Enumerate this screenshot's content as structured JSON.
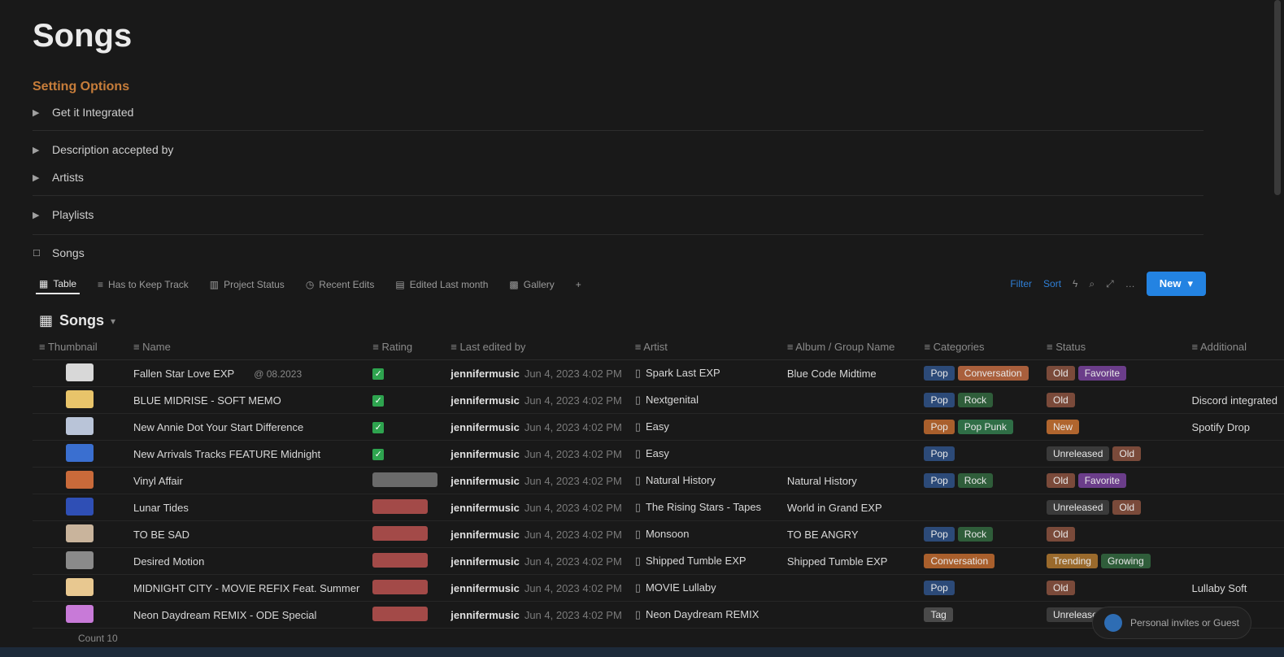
{
  "page": {
    "title": "Songs"
  },
  "setup": {
    "label": "Setting Options",
    "items": [
      {
        "label": "Get it Integrated"
      },
      {
        "label": "Description accepted by"
      },
      {
        "label": "Artists"
      },
      {
        "label": "Playlists"
      },
      {
        "label": "Songs"
      }
    ]
  },
  "views": [
    {
      "label": "Table",
      "icon": "table-icon"
    },
    {
      "label": "Has to Keep Track",
      "icon": "list-icon"
    },
    {
      "label": "Project Status",
      "icon": "board-icon"
    },
    {
      "label": "Recent Edits",
      "icon": "clock-icon"
    },
    {
      "label": "Edited Last month",
      "icon": "calendar-icon"
    },
    {
      "label": "Gallery",
      "icon": "gallery-icon"
    }
  ],
  "toolbar": {
    "filter": "Filter",
    "sort": "Sort",
    "new_label": "New"
  },
  "database": {
    "title": "Songs"
  },
  "columns": [
    "Thumbnail",
    "Name",
    "Rating",
    "Last edited by",
    "Artist",
    "Album / Group Name",
    "Categories",
    "Status",
    "Additional"
  ],
  "rows": [
    {
      "thumb": "#d8d8d8",
      "name": "Fallen Star Love EXP",
      "extra": "@ 08.2023",
      "rating": "check",
      "author": "jennifermusic",
      "date": "Jun 4, 2023 4:02 PM",
      "artist": "Spark Last EXP",
      "album": "Blue Code Midtime",
      "categories": [
        {
          "t": "Pop",
          "c": "#2c4a78"
        },
        {
          "t": "Conversation",
          "c": "#a95f3c"
        }
      ],
      "status": [
        {
          "t": "Old",
          "c": "#7a4a3a"
        },
        {
          "t": "Favorite",
          "c": "#6b3d8a"
        }
      ],
      "additional": ""
    },
    {
      "thumb": "#e8c46a",
      "name": "BLUE MIDRISE - SOFT MEMO",
      "extra": "",
      "rating": "check",
      "author": "jennifermusic",
      "date": "Jun 4, 2023 4:02 PM",
      "artist": "Nextgenital",
      "album": "",
      "categories": [
        {
          "t": "Pop",
          "c": "#2c4a78"
        },
        {
          "t": "Rock",
          "c": "#2f5d3a"
        }
      ],
      "status": [
        {
          "t": "Old",
          "c": "#7a4a3a"
        }
      ],
      "additional": "Discord integrated"
    },
    {
      "thumb": "#b9c4d8",
      "name": "New Annie Dot Your Start Difference",
      "extra": "",
      "rating": "check",
      "author": "jennifermusic",
      "date": "Jun 4, 2023 4:02 PM",
      "artist": "Easy",
      "album": "",
      "categories": [
        {
          "t": "Pop",
          "c": "#a95f2c"
        },
        {
          "t": "Pop Punk",
          "c": "#2f6e46"
        }
      ],
      "status": [
        {
          "t": "New",
          "c": "#b0652e"
        }
      ],
      "additional": "Spotify Drop"
    },
    {
      "thumb": "#3a6fd0",
      "name": "New Arrivals Tracks FEATURE Midnight",
      "extra": "",
      "rating": "check",
      "author": "jennifermusic",
      "date": "Jun 4, 2023 4:02 PM",
      "artist": "Easy",
      "album": "",
      "categories": [
        {
          "t": "Pop",
          "c": "#2c4a78"
        }
      ],
      "status": [
        {
          "t": "Unreleased",
          "c": "#3a3a3a"
        },
        {
          "t": "Old",
          "c": "#7a4a3a"
        }
      ],
      "additional": ""
    },
    {
      "thumb": "#c96a3a",
      "name": "Vinyl Affair",
      "extra": "",
      "rating": "bar-gray",
      "author": "jennifermusic",
      "date": "Jun 4, 2023 4:02 PM",
      "artist": "Natural History",
      "album": "Natural History",
      "categories": [
        {
          "t": "Pop",
          "c": "#2c4a78"
        },
        {
          "t": "Rock",
          "c": "#2f5d3a"
        }
      ],
      "status": [
        {
          "t": "Old",
          "c": "#7a4a3a"
        },
        {
          "t": "Favorite",
          "c": "#6b3d8a"
        }
      ],
      "additional": ""
    },
    {
      "thumb": "#2f4fb5",
      "name": "Lunar Tides",
      "extra": "",
      "rating": "bar-red",
      "author": "jennifermusic",
      "date": "Jun 4, 2023 4:02 PM",
      "artist": "The Rising Stars - Tapes",
      "album": "World in Grand EXP",
      "categories": [],
      "status": [
        {
          "t": "Unreleased",
          "c": "#3a3a3a"
        },
        {
          "t": "Old",
          "c": "#7a4a3a"
        }
      ],
      "additional": ""
    },
    {
      "thumb": "#c9b49c",
      "name": "TO BE SAD",
      "extra": "",
      "rating": "bar-red",
      "author": "jennifermusic",
      "date": "Jun 4, 2023 4:02 PM",
      "artist": "Monsoon",
      "album": "TO BE ANGRY",
      "categories": [
        {
          "t": "Pop",
          "c": "#2c4a78"
        },
        {
          "t": "Rock",
          "c": "#2f5d3a"
        }
      ],
      "status": [
        {
          "t": "Old",
          "c": "#7a4a3a"
        }
      ],
      "additional": ""
    },
    {
      "thumb": "#8a8a8a",
      "name": "Desired Motion",
      "extra": "",
      "rating": "bar-red",
      "author": "jennifermusic",
      "date": "Jun 4, 2023 4:02 PM",
      "artist": "Shipped Tumble EXP",
      "album": "Shipped Tumble EXP",
      "categories": [
        {
          "t": "Conversation",
          "c": "#a95f2c"
        }
      ],
      "status": [
        {
          "t": "Trending",
          "c": "#9a6a2c"
        },
        {
          "t": "Growing",
          "c": "#2f5d3a"
        }
      ],
      "additional": ""
    },
    {
      "thumb": "#e8c890",
      "name": "MIDNIGHT CITY - MOVIE REFIX Feat. Summer",
      "extra": "",
      "rating": "bar-red",
      "author": "jennifermusic",
      "date": "Jun 4, 2023 4:02 PM",
      "artist": "MOVIE Lullaby",
      "album": "",
      "categories": [
        {
          "t": "Pop",
          "c": "#2c4a78"
        }
      ],
      "status": [
        {
          "t": "Old",
          "c": "#7a4a3a"
        }
      ],
      "additional": "Lullaby Soft"
    },
    {
      "thumb": "#c87ad8",
      "name": "Neon Daydream REMIX - ODE Special",
      "extra": "",
      "rating": "bar-red",
      "author": "jennifermusic",
      "date": "Jun 4, 2023 4:02 PM",
      "artist": "Neon Daydream REMIX",
      "album": "",
      "categories": [
        {
          "t": "Tag",
          "c": "#4a4a4a"
        }
      ],
      "status": [
        {
          "t": "Unreleased",
          "c": "#3a3a3a"
        }
      ],
      "additional": ""
    }
  ],
  "pager": {
    "label": "Count 10"
  },
  "floating": {
    "label": "Personal invites or Guest"
  }
}
